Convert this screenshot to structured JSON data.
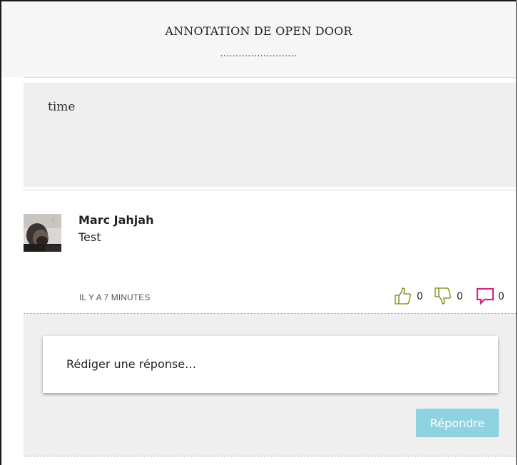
{
  "header": {
    "title": "ANNOTATION DE OPEN DOOR",
    "dots": "........................."
  },
  "quote": {
    "text": "time"
  },
  "comment": {
    "author": "Marc Jahjah",
    "text": "Test",
    "timestamp": "IL Y A 7 MINUTES",
    "likes": "0",
    "dislikes": "0",
    "replies": "0"
  },
  "reply": {
    "placeholder": "Rédiger une réponse…",
    "button_label": "Répondre"
  },
  "colors": {
    "like_icon": "#8a9a2c",
    "dislike_icon": "#8a9a2c",
    "reply_icon": "#d0287a",
    "reply_button": "#8ed3df"
  },
  "icons": {
    "like": "thumbs-up-icon",
    "dislike": "thumbs-down-icon",
    "reply": "speech-bubble-icon"
  }
}
